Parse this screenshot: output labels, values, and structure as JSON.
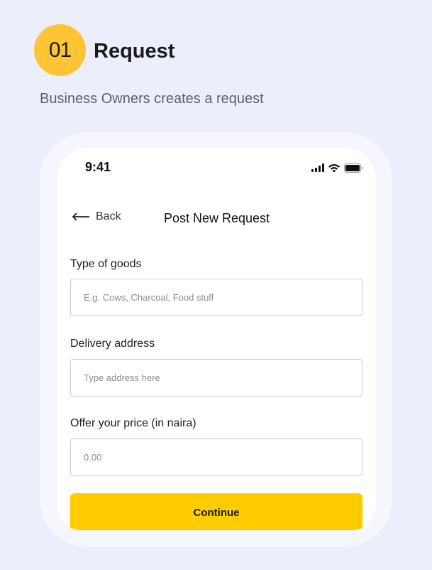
{
  "step": {
    "number": "01",
    "title": "Request",
    "subtitle": "Business Owners creates a request",
    "badge_color": "#FFC436"
  },
  "status_bar": {
    "time": "9:41",
    "icons": [
      "signal-icon",
      "wifi-icon",
      "battery-icon"
    ]
  },
  "nav": {
    "back_label": "Back",
    "back_icon": "back-arrow-icon",
    "title": "Post New Request"
  },
  "form": {
    "fields": [
      {
        "label": "Type of goods",
        "value": "",
        "placeholder": "E.g. Cows, Charcoal, Food stuff"
      },
      {
        "label": "Delivery address",
        "value": "",
        "placeholder": "Type address here"
      },
      {
        "label": "Offer your price (in naira)",
        "value": "",
        "placeholder": "0.00"
      }
    ],
    "submit_label": "Continue",
    "submit_color": "#FFCC00"
  }
}
